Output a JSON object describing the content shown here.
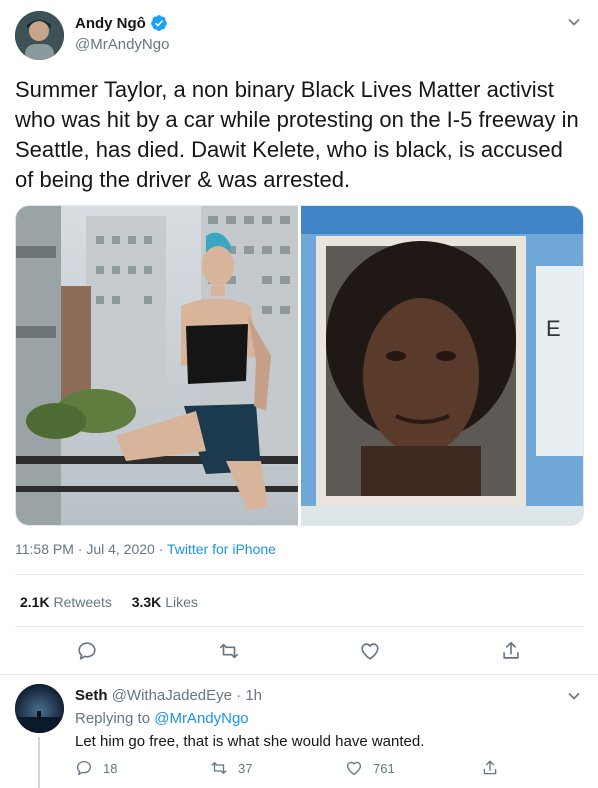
{
  "tweet": {
    "display_name": "Andy Ngô",
    "handle": "@MrAndyNgo",
    "text": "Summer Taylor, a non binary Black Lives Matter activist who was hit by a car while protesting on the I-5 freeway in Seattle, has died. Dawit Kelete, who is black, is accused of being the driver & was arrested.",
    "time_date": "11:58 PM · Jul 4, 2020 · ",
    "source": "Twitter for iPhone",
    "retweets_count": "2.1K",
    "retweets_label": "Retweets",
    "likes_count": "3.3K",
    "likes_label": "Likes",
    "media_right_text": "E"
  },
  "reply": {
    "display_name": "Seth",
    "handle": "@WithaJadedEye",
    "time": " · 1h",
    "replying_to_label": "Replying to ",
    "replying_to_handle": "@MrAndyNgo",
    "text": "Let him go free, that is what she would have wanted.",
    "reply_count": "18",
    "retweet_count": "37",
    "like_count": "761"
  },
  "colors": {
    "accent": "#1b95e0",
    "muted": "#657786",
    "verified": "#1da1f2"
  },
  "icons": [
    "verified-icon",
    "chevron-down-icon",
    "reply-icon",
    "retweet-icon",
    "like-icon",
    "share-icon"
  ]
}
